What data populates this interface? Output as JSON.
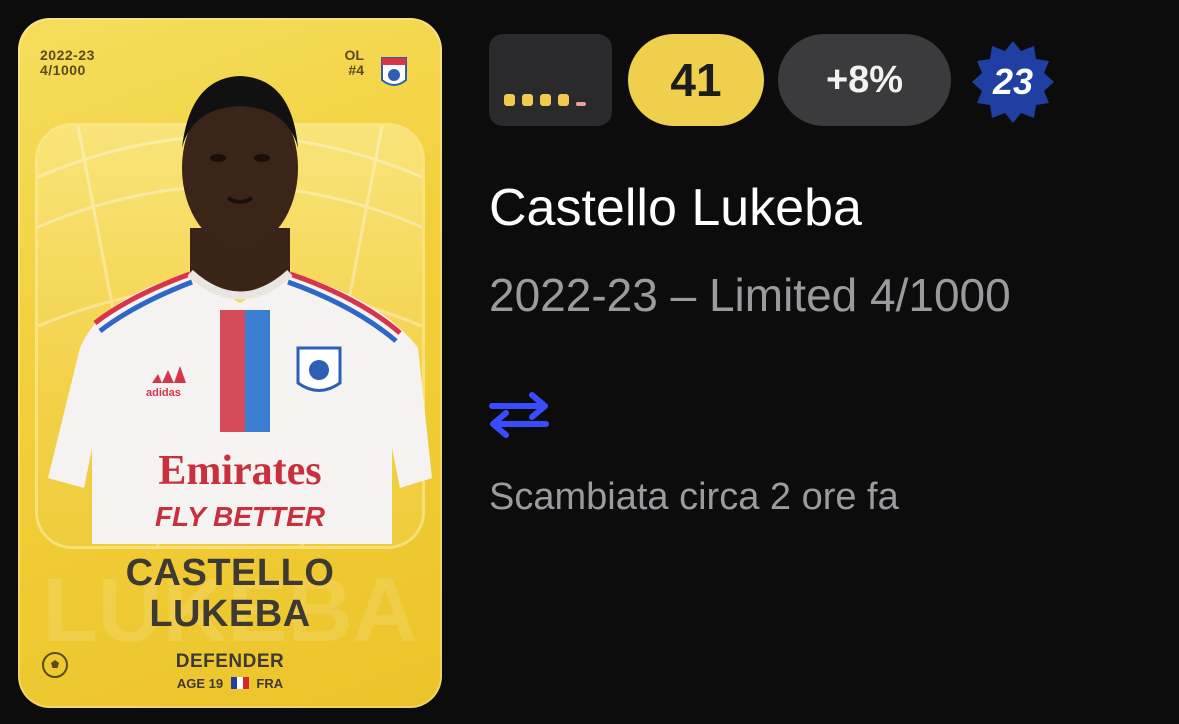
{
  "card": {
    "season_line1": "2022-23",
    "season_line2": "4/1000",
    "club_line1": "OL",
    "club_line2": "#4",
    "name_line1": "CASTELLO",
    "name_line2": "LUKEBA",
    "position": "DEFENDER",
    "age": "AGE 19",
    "nationality": "FRA",
    "shirt_text1": "Emirates",
    "shirt_text2": "FLY BETTER",
    "rarity_color": "#f2cf3a"
  },
  "stats": {
    "score": "41",
    "change": "+8%",
    "age_badge": "23",
    "form_color": "#f2c94c",
    "badge_color": "#1f3fa3"
  },
  "info": {
    "player_name": "Castello Lukeba",
    "edition": "2022-23 – Limited 4/1000",
    "traded_text": "Scambiata circa 2 ore fa",
    "swap_icon": "swap-arrows-icon",
    "swap_color": "#3a4cff"
  }
}
